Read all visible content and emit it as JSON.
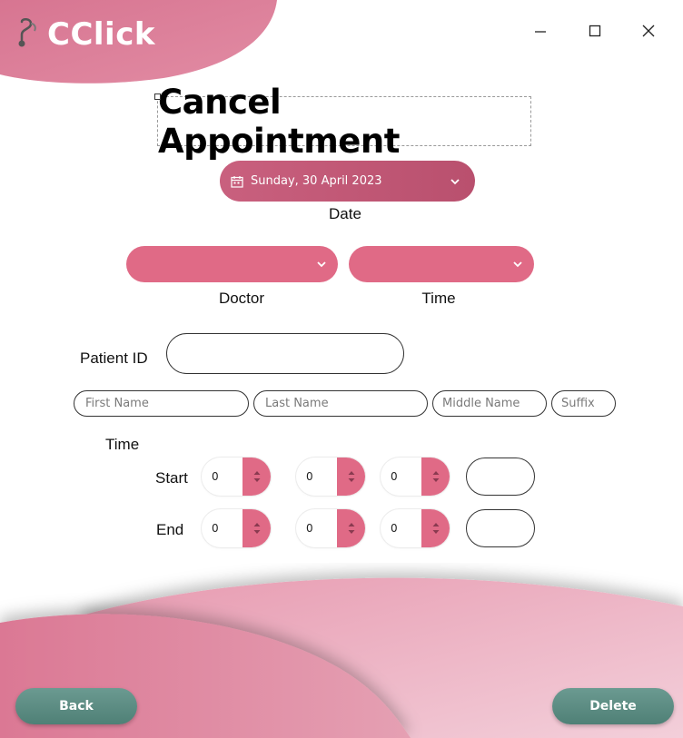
{
  "app": {
    "title": "CClick"
  },
  "window_controls": {
    "minimize": "minimize",
    "maximize": "maximize",
    "close": "close"
  },
  "colors": {
    "accent_pink": "#e06a86",
    "date_pink": "#c0587a",
    "button_teal": "#5d8d84",
    "wave_light": "#f2c9d5"
  },
  "page": {
    "title": "Cancel Appointment"
  },
  "date": {
    "value": "Sunday, 30 April 2023",
    "label": "Date",
    "icon": "calendar-icon"
  },
  "doctor": {
    "value": "",
    "label": "Doctor"
  },
  "time_select": {
    "value": "",
    "label": "Time"
  },
  "patient": {
    "id_label": "Patient ID",
    "id_value": "",
    "first_name_placeholder": "First Name",
    "last_name_placeholder": "Last Name",
    "middle_name_placeholder": "Middle Name",
    "suffix_placeholder": "Suffix"
  },
  "time_section": {
    "label": "Time",
    "start": {
      "label": "Start",
      "hour": "0",
      "minute": "0",
      "second": "0",
      "ampm": ""
    },
    "end": {
      "label": "End",
      "hour": "0",
      "minute": "0",
      "second": "0",
      "ampm": ""
    }
  },
  "actions": {
    "back": "Back",
    "delete": "Delete"
  }
}
